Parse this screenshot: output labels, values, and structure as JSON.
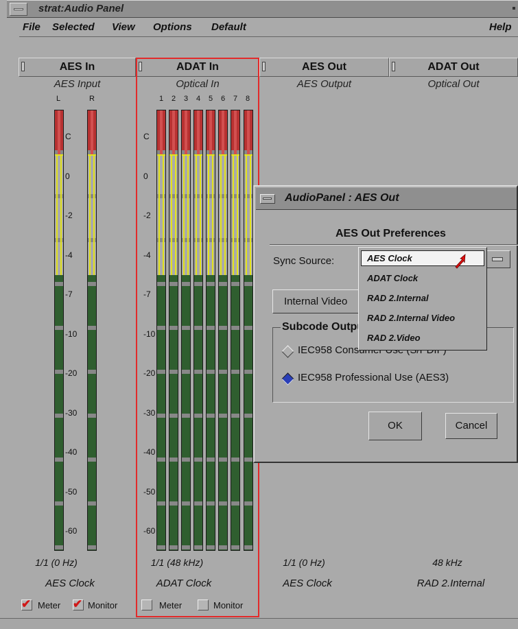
{
  "window": {
    "title": "strat:Audio Panel"
  },
  "menubar": {
    "items": [
      "File",
      "Selected",
      "View",
      "Options",
      "Default"
    ],
    "help": "Help"
  },
  "columns": [
    {
      "name": "AES In",
      "subtitle": "AES Input",
      "channels": [
        "L",
        "R"
      ],
      "rate": "1/1 (0 Hz)",
      "clock": "AES Clock"
    },
    {
      "name": "ADAT In",
      "subtitle": "Optical In",
      "channels": [
        "1",
        "2",
        "3",
        "4",
        "5",
        "6",
        "7",
        "8"
      ],
      "rate": "1/1 (48 kHz)",
      "clock": "ADAT Clock"
    },
    {
      "name": "AES Out",
      "subtitle": "AES Output",
      "rate": "1/1 (0 Hz)",
      "clock": "AES Clock"
    },
    {
      "name": "ADAT Out",
      "subtitle": "Optical Out",
      "rate": "48 kHz",
      "clock": "RAD 2.Internal"
    }
  ],
  "scale_labels": [
    "C",
    "0",
    "-2",
    "-4",
    "-7",
    "-10",
    "-20",
    "-30",
    "-40",
    "-50",
    "-60"
  ],
  "checkboxes": {
    "aes_in": {
      "meter": "Meter",
      "monitor": "Monitor",
      "meter_checked": true,
      "monitor_checked": true
    },
    "adat_in": {
      "meter": "Meter",
      "monitor": "Monitor",
      "meter_checked": false,
      "monitor_checked": false
    }
  },
  "dialog": {
    "title": "AudioPanel : AES Out",
    "heading": "AES Out Preferences",
    "sync_label": "Sync Source:",
    "internal_button": "Internal Video",
    "subcode_label": "Subcode Output",
    "radio1": "IEC958 Consumer Use (S/PDIF)",
    "radio2": "IEC958 Professional Use (AES3)",
    "ok": "OK",
    "cancel": "Cancel"
  },
  "dropdown": {
    "options": [
      "AES Clock",
      "ADAT Clock",
      "RAD 2.Internal",
      "RAD 2.Internal Video",
      "RAD 2.Video"
    ],
    "selected": "AES Clock"
  },
  "colors": {
    "meter_green": "#2f5e2f",
    "meter_yellow": "#e3e31c",
    "meter_red": "#b83232",
    "highlight_border": "#e22a2a",
    "selected_radio": "#2a3fb8"
  }
}
